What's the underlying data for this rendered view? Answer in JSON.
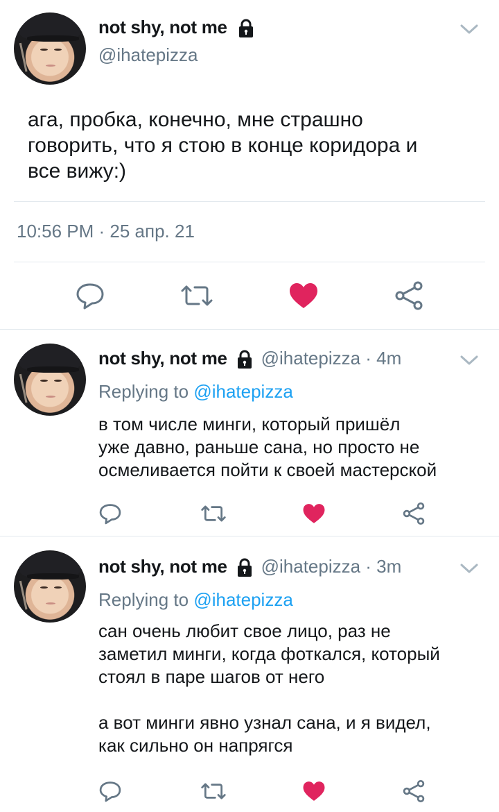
{
  "main_tweet": {
    "display_name": "not shy, not me",
    "handle": "@ihatepizza",
    "text_lines": [
      "ага, пробка, конечно, мне страшно",
      "говорить, что я стою в конце коридора и",
      "все вижу:)"
    ],
    "timestamp": "10:56 PM · 25 апр. 21"
  },
  "replies": [
    {
      "display_name": "not shy, not me",
      "handle_time": "@ihatepizza · 4m",
      "replying_prefix": "Replying to",
      "replying_to": "@ihatepizza",
      "text_lines": [
        "в том числе минги, который пришёл",
        "уже давно, раньше сана, но просто не",
        "осмеливается пойти к своей мастерской"
      ]
    },
    {
      "display_name": "not shy, not me",
      "handle_time": "@ihatepizza · 3m",
      "replying_prefix": "Replying to",
      "replying_to": "@ihatepizza",
      "text_lines": [
        "сан очень любит свое лицо, раз не",
        "заметил минги, когда фоткался, который",
        "стоял в паре шагов от него",
        "",
        "а вот минги явно узнал сана, и я видел,",
        "как сильно он напрягся"
      ]
    }
  ],
  "colors": {
    "like_active": "#e0245e",
    "icon_gray": "#657786",
    "link_blue": "#1da1f2",
    "divider": "#e1e8ed"
  },
  "icons": [
    "chevron-down-icon",
    "lock-icon",
    "reply-icon",
    "retweet-icon",
    "like-icon",
    "share-icon"
  ]
}
